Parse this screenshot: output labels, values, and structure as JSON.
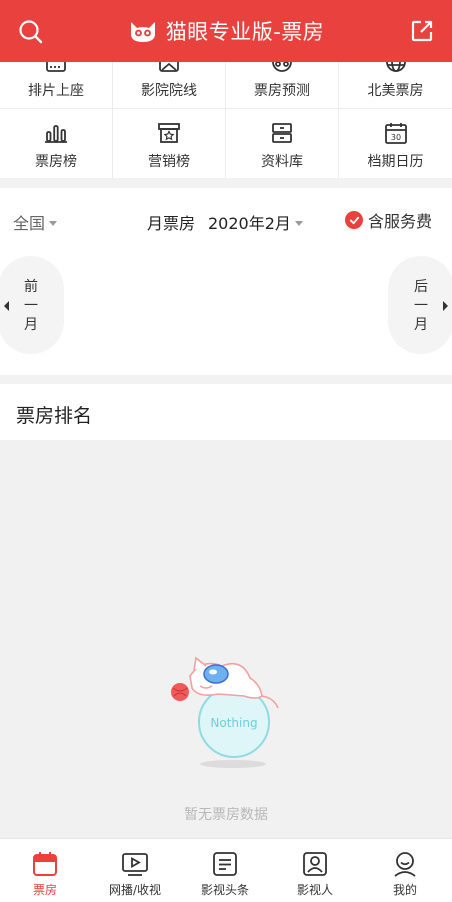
{
  "header": {
    "title": "猫眼专业版-票房",
    "search_icon": "search-icon",
    "share_icon": "share-external-icon",
    "brand_color": "#e8413e"
  },
  "menu": {
    "row1": [
      {
        "label": "排片上座",
        "icon": "schedule-icon"
      },
      {
        "label": "影院院线",
        "icon": "cinema-icon"
      },
      {
        "label": "票房预测",
        "icon": "forecast-icon"
      },
      {
        "label": "北美票房",
        "icon": "globe-icon"
      }
    ],
    "row2": [
      {
        "label": "票房榜",
        "icon": "bar-chart-icon"
      },
      {
        "label": "营销榜",
        "icon": "marketing-icon"
      },
      {
        "label": "资料库",
        "icon": "database-icon"
      },
      {
        "label": "档期日历",
        "icon": "calendar-icon"
      }
    ]
  },
  "filter": {
    "region": "全国",
    "type_label": "月票房",
    "month": "2020年2月",
    "fee_label": "含服务费",
    "fee_checked": true,
    "prev_label": [
      "前",
      "一",
      "月"
    ],
    "next_label": [
      "后",
      "一",
      "月"
    ]
  },
  "ranking": {
    "title": "票房排名",
    "empty_badge": "Nothing",
    "empty_text": "暂无票房数据"
  },
  "tabbar": {
    "items": [
      {
        "label": "票房",
        "icon": "calendar-icon",
        "active": true
      },
      {
        "label": "网播/收视",
        "icon": "play-icon",
        "active": false
      },
      {
        "label": "影视头条",
        "icon": "news-icon",
        "active": false
      },
      {
        "label": "影视人",
        "icon": "person-card-icon",
        "active": false
      },
      {
        "label": "我的",
        "icon": "user-icon",
        "active": false
      }
    ]
  }
}
